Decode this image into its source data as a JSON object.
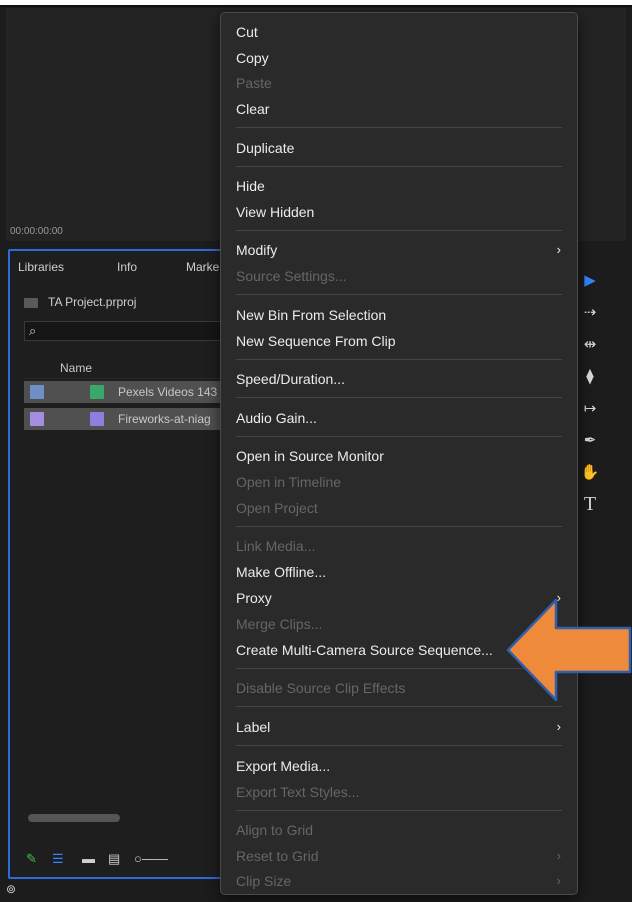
{
  "monitor": {
    "timecode": "00:00:00:00"
  },
  "project_panel": {
    "tabs": [
      "Libraries",
      "Info",
      "Marke"
    ],
    "project_name": "TA Project.prproj",
    "search_placeholder": "",
    "column_name": "Name",
    "items": [
      {
        "label": "Pexels Videos 143",
        "swatch_color": "#6f8fc9",
        "icon_color": "#3aa86a"
      },
      {
        "label": "Fireworks-at-niag",
        "swatch_color": "#a58ee0",
        "icon_color": "#8f7ee0"
      }
    ]
  },
  "context_menu": {
    "items": [
      {
        "label": "Cut",
        "enabled": true
      },
      {
        "label": "Copy",
        "enabled": true
      },
      {
        "label": "Paste",
        "enabled": false
      },
      {
        "label": "Clear",
        "enabled": true
      },
      {
        "label": "Duplicate",
        "enabled": true
      },
      {
        "label": "Hide",
        "enabled": true
      },
      {
        "label": "View Hidden",
        "enabled": true
      },
      {
        "label": "Modify",
        "enabled": true,
        "submenu": true
      },
      {
        "label": "Source Settings...",
        "enabled": false
      },
      {
        "label": "New Bin From Selection",
        "enabled": true
      },
      {
        "label": "New Sequence From Clip",
        "enabled": true
      },
      {
        "label": "Speed/Duration...",
        "enabled": true
      },
      {
        "label": "Audio Gain...",
        "enabled": true
      },
      {
        "label": "Open in Source Monitor",
        "enabled": true
      },
      {
        "label": "Open in Timeline",
        "enabled": false
      },
      {
        "label": "Open Project",
        "enabled": false
      },
      {
        "label": "Link Media...",
        "enabled": false
      },
      {
        "label": "Make Offline...",
        "enabled": true
      },
      {
        "label": "Proxy",
        "enabled": true,
        "submenu": true
      },
      {
        "label": "Merge Clips...",
        "enabled": false
      },
      {
        "label": "Create Multi-Camera Source Sequence...",
        "enabled": true
      },
      {
        "label": "Disable Source Clip Effects",
        "enabled": false
      },
      {
        "label": "Label",
        "enabled": true,
        "submenu": true
      },
      {
        "label": "Export Media...",
        "enabled": true
      },
      {
        "label": "Export Text Styles...",
        "enabled": false
      },
      {
        "label": "Align to Grid",
        "enabled": false
      },
      {
        "label": "Reset to Grid",
        "enabled": false,
        "submenu": true
      },
      {
        "label": "Clip Size",
        "enabled": false,
        "submenu": true
      }
    ]
  },
  "annotation": {
    "arrow_color": "#ee8a3a",
    "arrow_outline": "#2f5fae"
  },
  "colors": {
    "panel_focus": "#2f6bd8",
    "tool_active": "#2f86ff"
  }
}
